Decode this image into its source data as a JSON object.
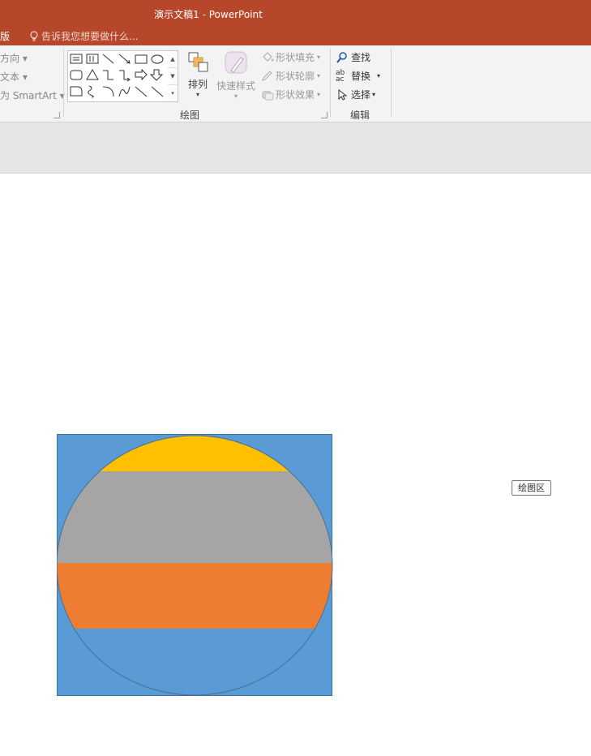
{
  "window": {
    "title": "演示文稿1 - PowerPoint"
  },
  "tabs": {
    "partial_tab": "版",
    "tell_me": "告诉我您想要做什么..."
  },
  "paragraph_group": {
    "items": [
      {
        "label": "文字方向",
        "visible": "方向"
      },
      {
        "label": "对齐文本",
        "visible": "文本"
      },
      {
        "label": "转换为 SmartArt",
        "visible": "为 SmartArt"
      }
    ]
  },
  "drawing_group": {
    "label": "绘图",
    "arrange_label": "排列",
    "quick_styles_label": "快速样式",
    "shape_fill": "形状填充",
    "shape_outline": "形状轮廓",
    "shape_effects": "形状效果"
  },
  "editing_group": {
    "label": "编辑",
    "find": "查找",
    "replace": "替换",
    "select": "选择"
  },
  "tooltip": {
    "text": "绘图区"
  },
  "chart_data": {
    "type": "area",
    "colors": {
      "background": "#5b9bd5",
      "gray": "#a5a5a5",
      "orange": "#ed7d31",
      "yellow": "#ffc000",
      "outline": "#41719c"
    }
  }
}
